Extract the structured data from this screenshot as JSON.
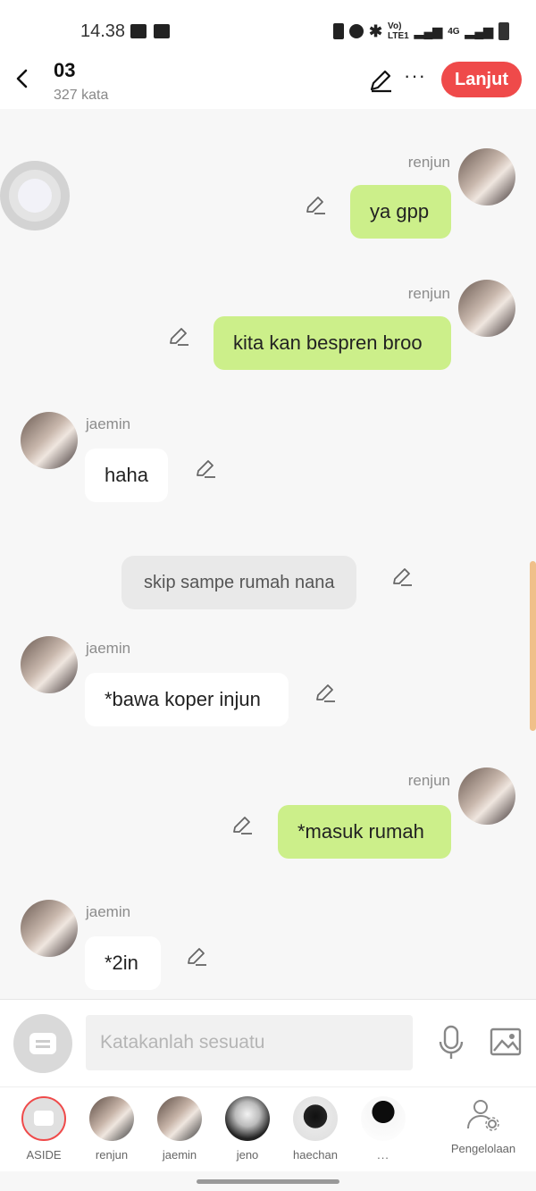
{
  "status": {
    "time": "14.38",
    "network": "4G"
  },
  "header": {
    "title": "03",
    "word_count": "327 kata",
    "continue_label": "Lanjut"
  },
  "messages": [
    {
      "type": "right",
      "name": "renjun",
      "text": "ya gpp"
    },
    {
      "type": "right",
      "name": "renjun",
      "text": "kita kan bespren broo"
    },
    {
      "type": "left",
      "name": "jaemin",
      "text": "haha"
    },
    {
      "type": "narration",
      "text": "skip sampe rumah nana"
    },
    {
      "type": "left",
      "name": "jaemin",
      "text": "*bawa koper injun"
    },
    {
      "type": "right",
      "name": "renjun",
      "text": "*masuk rumah"
    },
    {
      "type": "left",
      "name": "jaemin",
      "text": "*2in"
    }
  ],
  "input": {
    "placeholder": "Katakanlah sesuatu"
  },
  "cast": [
    {
      "label": "ASIDE"
    },
    {
      "label": "renjun"
    },
    {
      "label": "jaemin"
    },
    {
      "label": "jeno"
    },
    {
      "label": "haechan"
    },
    {
      "label": "..."
    }
  ],
  "management_label": "Pengelolaan",
  "colors": {
    "accent": "#ef4a4a",
    "bubble_right": "#ccef8a",
    "bubble_left": "#ffffff"
  }
}
